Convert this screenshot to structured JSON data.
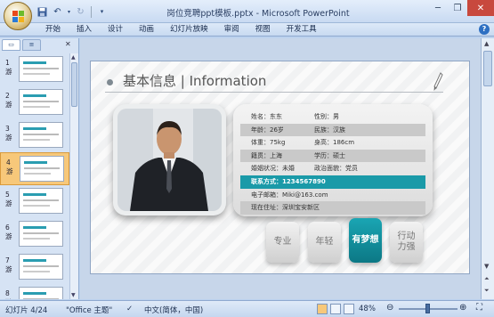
{
  "window": {
    "title": "岗位竞聘ppt模板.pptx - Microsoft PowerPoint"
  },
  "ribbon": {
    "tabs": [
      "开始",
      "插入",
      "设计",
      "动画",
      "幻灯片放映",
      "审阅",
      "视图",
      "开发工具"
    ]
  },
  "panel": {
    "tabs": [
      "slides",
      "outline"
    ],
    "slides": [
      {
        "num": "1",
        "sub": "游"
      },
      {
        "num": "2",
        "sub": "游"
      },
      {
        "num": "3",
        "sub": "游"
      },
      {
        "num": "4",
        "sub": "游"
      },
      {
        "num": "5",
        "sub": "游"
      },
      {
        "num": "6",
        "sub": "游"
      },
      {
        "num": "7",
        "sub": "游"
      },
      {
        "num": "8",
        "sub": "游"
      }
    ],
    "selected_index": 4
  },
  "slide": {
    "title": "基本信息 | Information",
    "info": {
      "name": "姓名：东东",
      "gender": "性别：男",
      "age": "年龄：26岁",
      "ethnicity": "民族：汉族",
      "weight": "体重：75kg",
      "height": "身高：186cm",
      "origin": "籍贯：上海",
      "education": "学历：硕士",
      "marital": "婚姻状况：未婚",
      "political": "政治面貌：党员",
      "contact": "联系方式：1234567890",
      "email": "电子邮箱：Miki@163.com",
      "address": "现在住址：深圳宝安新区"
    },
    "tags": [
      {
        "label": "专业",
        "active": false
      },
      {
        "label": "年轻",
        "active": false
      },
      {
        "label": "有梦想",
        "active": true
      },
      {
        "label": "行动\n力强",
        "active": false
      }
    ]
  },
  "statusbar": {
    "slide_counter": "幻灯片 4/24",
    "theme": "\"Office 主题\"",
    "language": "中文(简体，中国)",
    "zoom": "48%"
  },
  "icons": [
    "office-button-icon",
    "save-icon",
    "undo-icon",
    "redo-icon",
    "pen-icon",
    "check-icon",
    "zoom-out-icon",
    "zoom-in-icon",
    "fit-window-icon"
  ]
}
